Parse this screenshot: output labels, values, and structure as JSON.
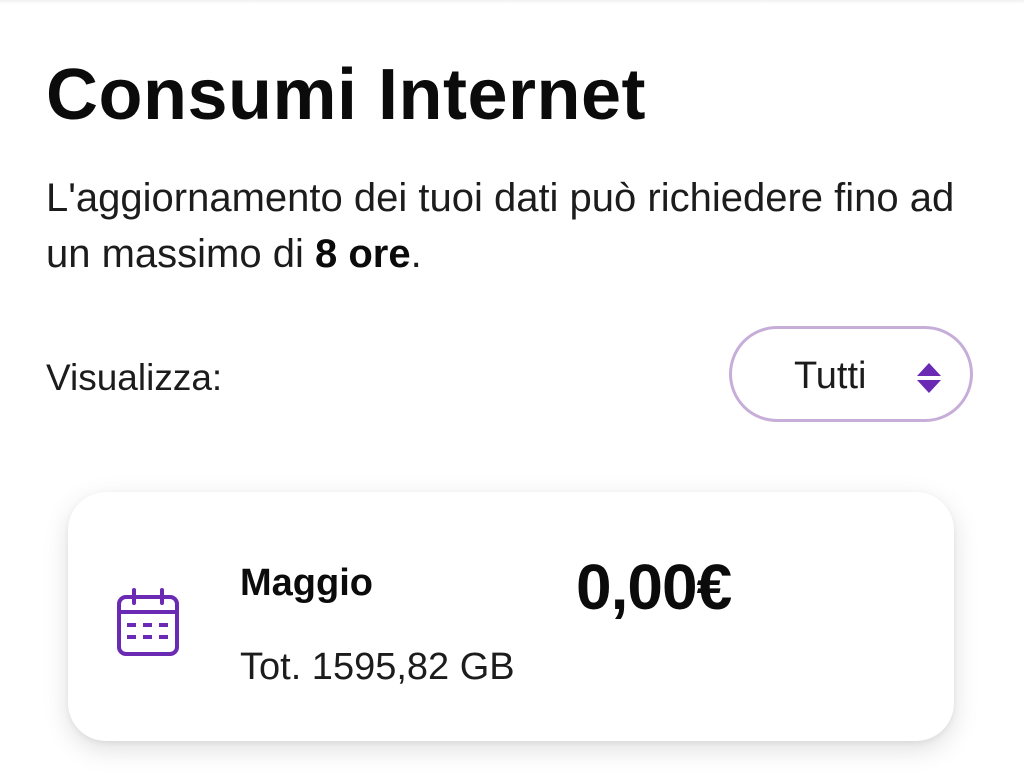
{
  "header": {
    "title": "Consumi Internet",
    "subtitle_text": "L'aggiornamento dei tuoi dati può richiedere fino ad un massimo di ",
    "subtitle_bold": "8 ore",
    "subtitle_end": "."
  },
  "filter": {
    "label": "Visualizza:",
    "selected": "Tutti",
    "icon": "sort-updown-icon"
  },
  "usage_card": {
    "month": "Maggio",
    "amount": "0,00€",
    "total": "Tot. 1595,82 GB",
    "icon": "calendar-icon"
  },
  "colors": {
    "accent": "#6a2ab4",
    "select_border": "#c6aed8",
    "text": "#111111"
  }
}
